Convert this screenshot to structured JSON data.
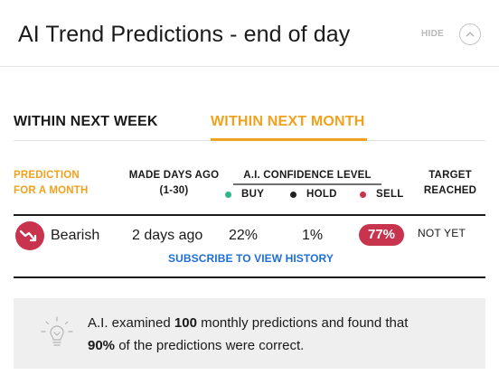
{
  "header": {
    "title": "AI Trend Predictions - end of day",
    "hide_label": "HIDE"
  },
  "tabs": [
    {
      "label": "WITHIN NEXT WEEK",
      "active": false
    },
    {
      "label": "WITHIN NEXT MONTH",
      "active": true
    }
  ],
  "table": {
    "headers": {
      "prediction_line1": "PREDICTION",
      "prediction_line2": "FOR A MONTH",
      "made_line1": "MADE DAYS AGO",
      "made_line2": "(1-30)",
      "confidence": "A.I. CONFIDENCE LEVEL",
      "target_line1": "TARGET",
      "target_line2": "REACHED"
    },
    "legend": [
      {
        "label": "BUY",
        "color": "#2bb58a"
      },
      {
        "label": "HOLD",
        "color": "#222222"
      },
      {
        "label": "SELL",
        "color": "#c8334d"
      }
    ],
    "row": {
      "prediction": "Bearish",
      "prediction_icon": "trend-down-icon",
      "made_days_ago": "2 days ago",
      "buy": "22%",
      "hold": "1%",
      "sell": "77%",
      "target_reached": "NOT YET"
    },
    "subscribe_link": "SUBSCRIBE TO VIEW HISTORY"
  },
  "info": {
    "icon": "lightbulb-icon",
    "part1": "A.I. examined ",
    "count": "100",
    "part2": " monthly predictions and found that",
    "percent": "90%",
    "part3": " of the predictions were correct."
  },
  "colors": {
    "accent": "#f0a21e",
    "bearish": "#c8334d",
    "link": "#1d6fd6"
  }
}
